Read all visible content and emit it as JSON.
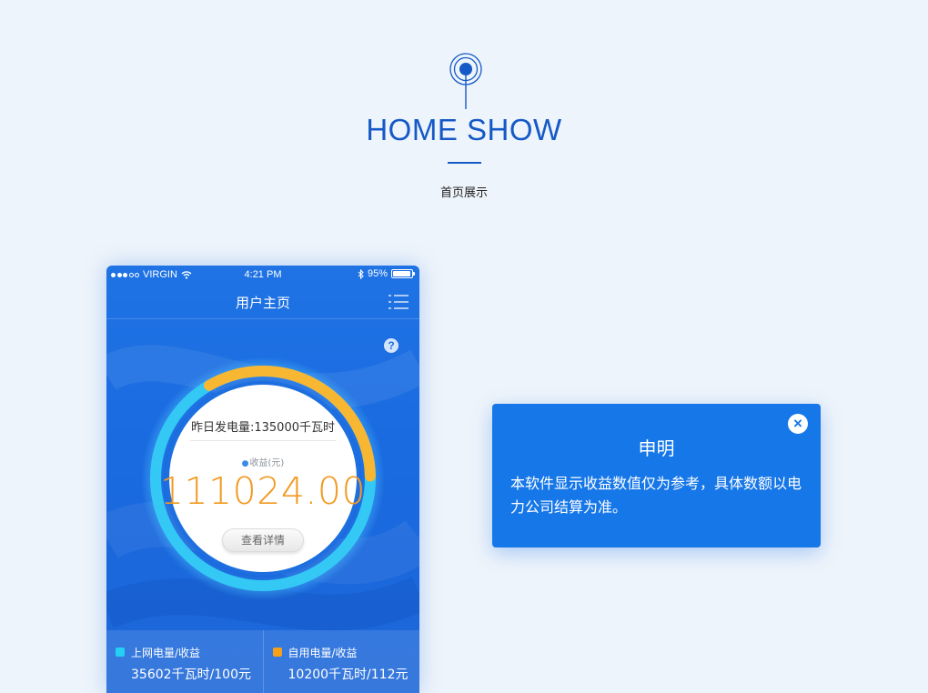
{
  "header": {
    "title": "HOME SHOW",
    "subtitle": "首页展示",
    "icon": "radar-pin-icon",
    "accent": "#1559c6"
  },
  "phone": {
    "status": {
      "carrier": "VIRGIN",
      "time": "4:21 PM",
      "battery": "95%",
      "battery_level": 0.95,
      "icons": [
        "signal-dots-icon",
        "wifi-icon",
        "bluetooth-icon",
        "battery-icon"
      ]
    },
    "nav": {
      "title": "用户主页",
      "menu_icon": "list-menu-icon"
    },
    "help_icon": "?",
    "gauge": {
      "yesterday_generation": "昨日发电量:135000千瓦时",
      "income_label": "收益(元)",
      "income_value": "111024.00",
      "details_button": "查看详情",
      "progress": 0.75,
      "ring_color": "#34c9f5",
      "progress_color": "#f7b733"
    },
    "stats": [
      {
        "label": "上网电量/收益",
        "value": "35602千瓦时/100元",
        "color": "#25d0f5"
      },
      {
        "label": "自用电量/收益",
        "value": "10200千瓦时/112元",
        "color": "#f7a11a"
      }
    ]
  },
  "dialog": {
    "title": "申明",
    "body": "本软件显示收益数值仅为参考，具体数额以电力公司结算为准。",
    "close_icon": "×",
    "background": "#1677e8"
  }
}
